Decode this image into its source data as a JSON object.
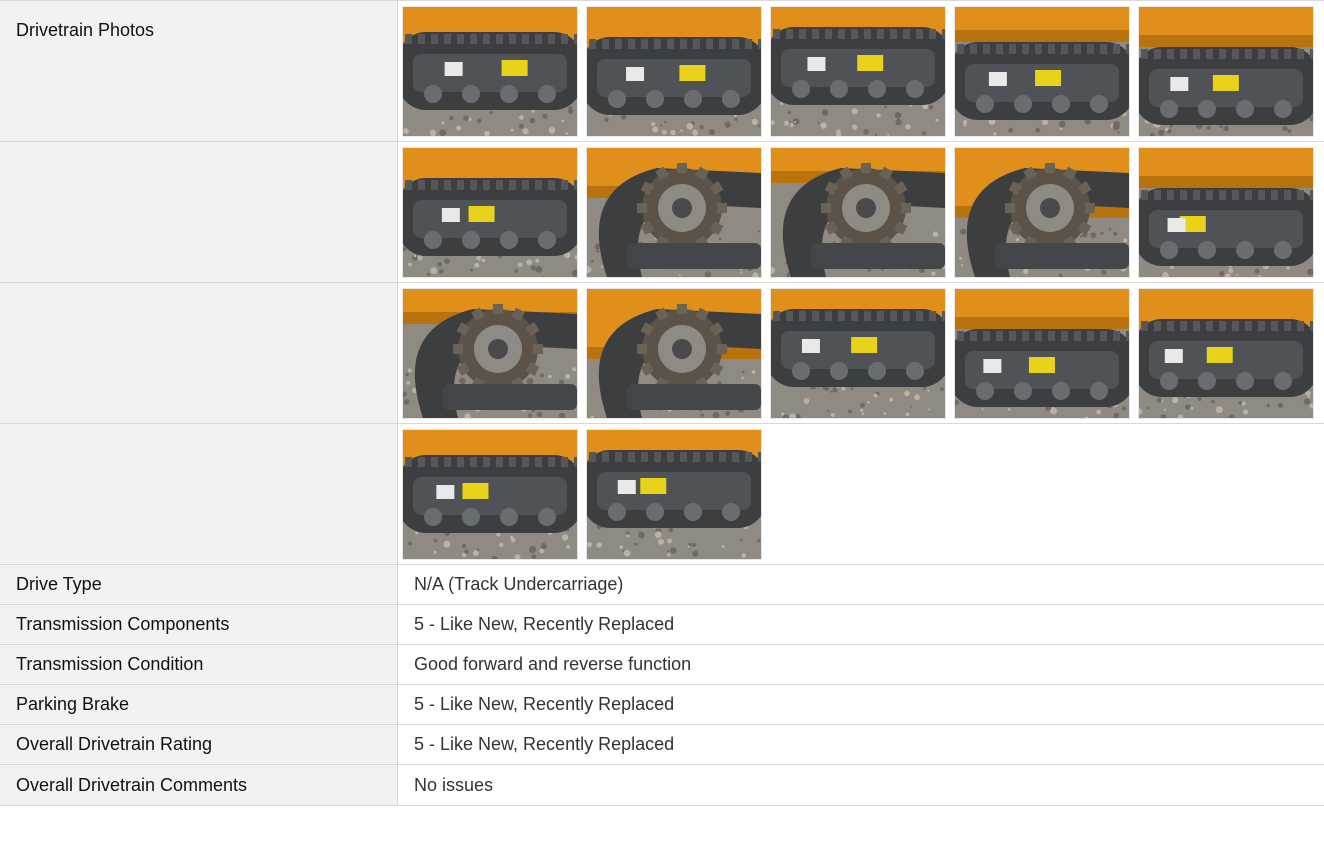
{
  "photo_section": {
    "label": "Drivetrain Photos",
    "rows": [
      {
        "photos": [
          {
            "icon": "track-undercarriage-photo",
            "tone": "a"
          },
          {
            "icon": "track-undercarriage-photo",
            "tone": "b"
          },
          {
            "icon": "track-undercarriage-photo",
            "tone": "c"
          },
          {
            "icon": "track-sprocket-photo",
            "tone": "d"
          },
          {
            "icon": "track-roller-photo",
            "tone": "e"
          }
        ]
      },
      {
        "photos": [
          {
            "icon": "track-frame-photo",
            "tone": "b"
          },
          {
            "icon": "sprocket-photo",
            "tone": "c"
          },
          {
            "icon": "sprocket-photo",
            "tone": "d"
          },
          {
            "icon": "sprocket-photo",
            "tone": "a"
          },
          {
            "icon": "track-photo",
            "tone": "e"
          }
        ]
      },
      {
        "photos": [
          {
            "icon": "sprocket-hub-photo",
            "tone": "d"
          },
          {
            "icon": "sprocket-hub-photo",
            "tone": "a"
          },
          {
            "icon": "track-roller-photo",
            "tone": "c"
          },
          {
            "icon": "track-roller-photo",
            "tone": "e"
          },
          {
            "icon": "track-idler-photo",
            "tone": "b"
          }
        ]
      },
      {
        "photos": [
          {
            "icon": "track-frame-photo",
            "tone": "a"
          },
          {
            "icon": "track-undercarriage-photo",
            "tone": "c"
          }
        ]
      }
    ]
  },
  "fields": [
    {
      "label": "Drive Type",
      "value": "N/A (Track Undercarriage)"
    },
    {
      "label": "Transmission Components",
      "value": "5 - Like New, Recently Replaced"
    },
    {
      "label": "Transmission Condition",
      "value": "Good forward and reverse function"
    },
    {
      "label": "Parking Brake",
      "value": "5 - Like New, Recently Replaced"
    },
    {
      "label": "Overall Drivetrain Rating",
      "value": "5 - Like New, Recently Replaced"
    },
    {
      "label": "Overall Drivetrain Comments",
      "value": "No issues"
    }
  ],
  "colors": {
    "machine_orange": "#e0901a",
    "track_rubber": "#3d3e40",
    "ground": "#8f8a82",
    "decal_yellow": "#e8d21a"
  }
}
